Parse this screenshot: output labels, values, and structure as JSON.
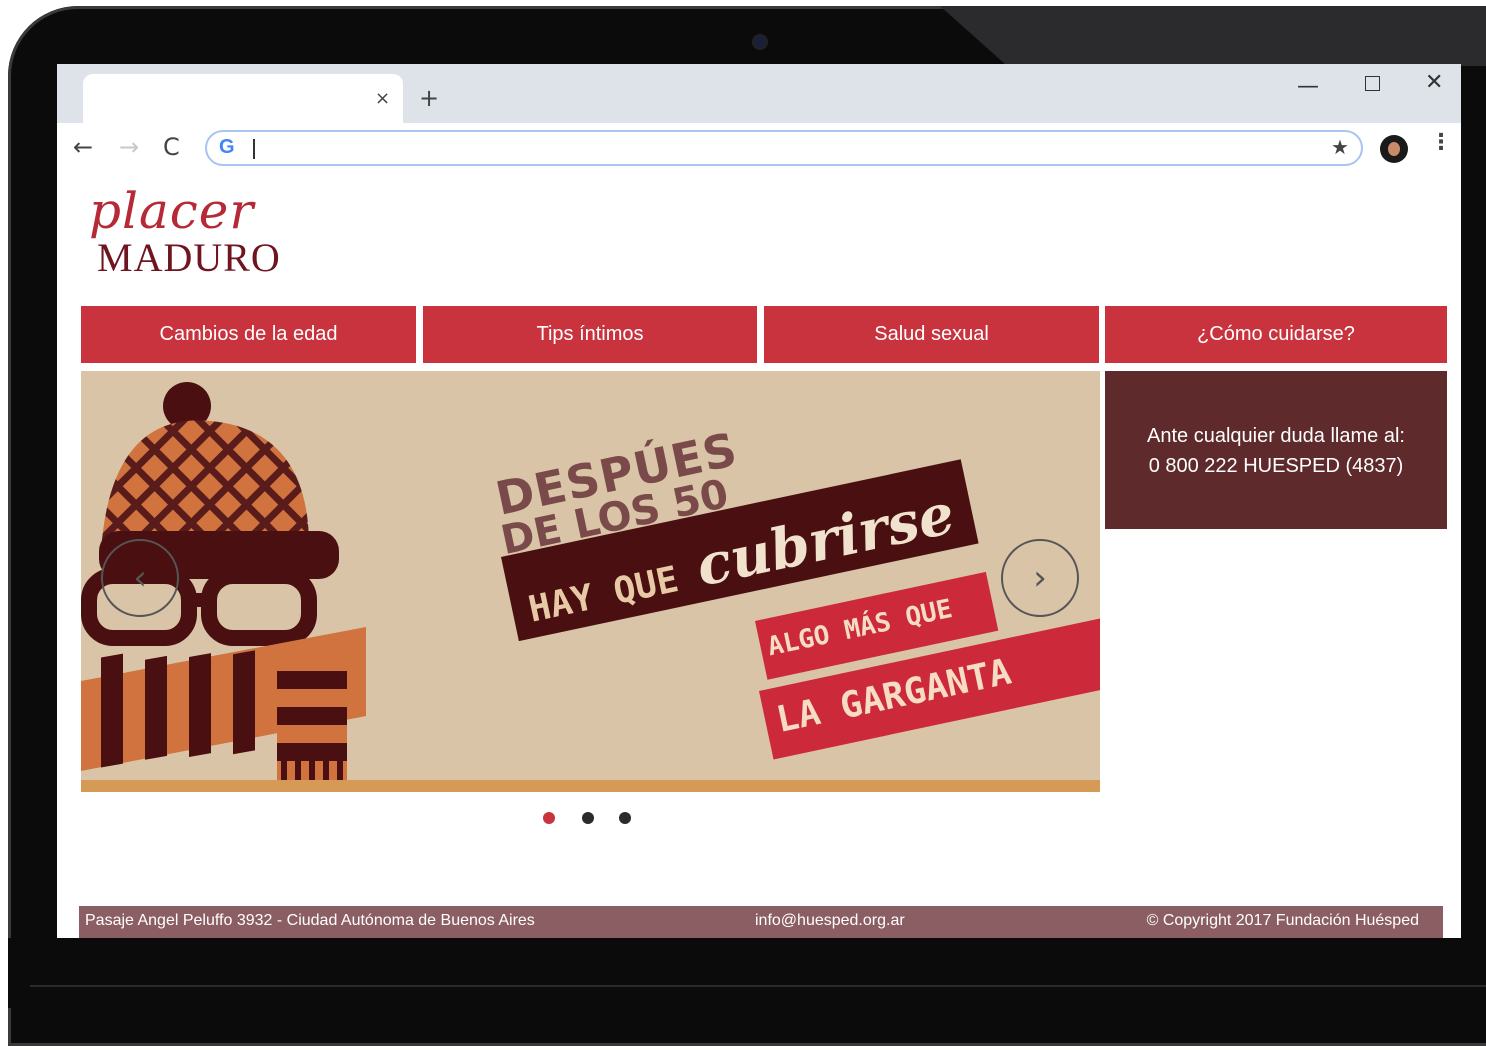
{
  "browser": {
    "tab_close": "×",
    "new_tab": "+",
    "window_minimize": "—",
    "window_close": "✕",
    "nav_back": "←",
    "nav_forward": "→",
    "nav_reload": "C",
    "google_letter": "G",
    "bookmark_star": "★",
    "menu_dots": "⋮",
    "omnibox_value": ""
  },
  "logo": {
    "script": "placer",
    "caps": "MADURO"
  },
  "nav": {
    "items": [
      {
        "label": "Cambios de la edad"
      },
      {
        "label": "Tips íntimos"
      },
      {
        "label": "Salud sexual"
      },
      {
        "label": "¿Cómo cuidarse?"
      }
    ]
  },
  "carousel": {
    "prev_arrow": "‹",
    "next_arrow": "›",
    "headline1": "DESPÚES",
    "headline2": "DE LOS 50",
    "band1_prefix": "HAY QUE ",
    "band1_script": "cubrirse",
    "band2": "ALGO MÁS QUE",
    "band3": "LA GARGANTA",
    "slide_count": 3,
    "active_index": 0,
    "colors": {
      "active_dot": "#c8333d",
      "inactive_dot": "#2b2b2b"
    }
  },
  "info_box": {
    "line1": "Ante cualquier duda llame al:",
    "line2": "0 800 222 HUESPED (4837)"
  },
  "footer": {
    "address": "Pasaje Angel Peluffo 3932 - Ciudad Autónoma de Buenos Aires",
    "email": "info@huesped.org.ar",
    "copyright": "© Copyright 2017 Fundación Huésped"
  },
  "colors": {
    "nav_red": "#c8333d",
    "info_bg": "#5e2a2c",
    "footer_bg": "#8b5e63",
    "logo_red": "#b52a36",
    "logo_dark": "#6e1520"
  }
}
